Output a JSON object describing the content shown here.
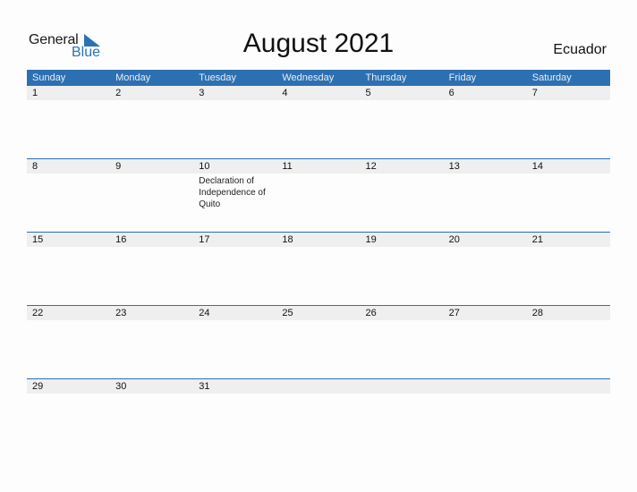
{
  "logo": {
    "word1": "General",
    "word2": "Blue"
  },
  "title": "August 2021",
  "country": "Ecuador",
  "weekdays": [
    "Sunday",
    "Monday",
    "Tuesday",
    "Wednesday",
    "Thursday",
    "Friday",
    "Saturday"
  ],
  "weeks": [
    {
      "days": [
        "1",
        "2",
        "3",
        "4",
        "5",
        "6",
        "7"
      ],
      "events": [
        "",
        "",
        "",
        "",
        "",
        "",
        ""
      ]
    },
    {
      "days": [
        "8",
        "9",
        "10",
        "11",
        "12",
        "13",
        "14"
      ],
      "events": [
        "",
        "",
        "Declaration of Independence of Quito",
        "",
        "",
        "",
        ""
      ]
    },
    {
      "days": [
        "15",
        "16",
        "17",
        "18",
        "19",
        "20",
        "21"
      ],
      "events": [
        "",
        "",
        "",
        "",
        "",
        "",
        ""
      ]
    },
    {
      "days": [
        "22",
        "23",
        "24",
        "25",
        "26",
        "27",
        "28"
      ],
      "events": [
        "",
        "",
        "",
        "",
        "",
        "",
        ""
      ]
    },
    {
      "days": [
        "29",
        "30",
        "31",
        "",
        "",
        "",
        ""
      ],
      "events": [
        "",
        "",
        "",
        "",
        "",
        "",
        ""
      ]
    }
  ],
  "colors": {
    "accent": "#2d70b1",
    "strip": "#efefef"
  }
}
